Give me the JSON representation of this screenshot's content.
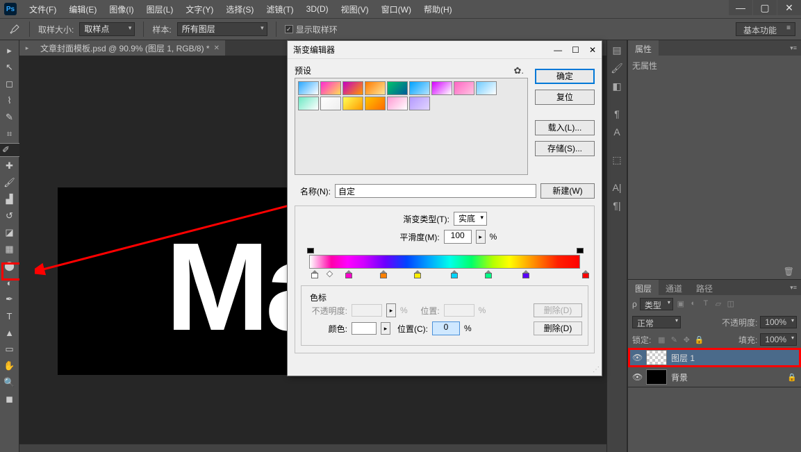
{
  "menu": [
    "文件(F)",
    "编辑(E)",
    "图像(I)",
    "图层(L)",
    "文字(Y)",
    "选择(S)",
    "滤镜(T)",
    "3D(D)",
    "视图(V)",
    "窗口(W)",
    "帮助(H)"
  ],
  "optbar": {
    "sample_size_label": "取样大小:",
    "sample_size_value": "取样点",
    "sample_label": "样本:",
    "sample_value": "所有图层",
    "show_ring": "显示取样环"
  },
  "workspace": "基本功能",
  "document_tab": "文章封面模板.psd @ 90.9% (图层 1, RGB/8) *",
  "canvas_text": "Ma",
  "properties": {
    "tab": "属性",
    "empty": "无属性"
  },
  "layers_panel": {
    "tabs": [
      "图层",
      "通道",
      "路径"
    ],
    "kind": "类型",
    "blend": "正常",
    "opacity_label": "不透明度:",
    "opacity_value": "100%",
    "lock_label": "锁定:",
    "fill_label": "填充:",
    "fill_value": "100%",
    "layers": [
      {
        "name": "图层 1"
      },
      {
        "name": "背景"
      }
    ]
  },
  "dialog": {
    "title": "渐变编辑器",
    "preset_label": "预设",
    "ok": "确定",
    "reset": "复位",
    "load": "载入(L)...",
    "save": "存储(S)...",
    "name_label": "名称(N):",
    "name_value": "自定",
    "new_btn": "新建(W)",
    "grad_type_label": "渐变类型(T):",
    "grad_type_value": "实底",
    "smooth_label": "平滑度(M):",
    "smooth_value": "100",
    "pct": "%",
    "stops_label": "色标",
    "opacity_label": "不透明度:",
    "location_label": "位置:",
    "location_label_c": "位置(C):",
    "location_value": "0",
    "color_label": "颜色:",
    "delete": "删除(D)"
  },
  "swatches": [
    "linear-gradient(135deg,#2aa8ff,#fff)",
    "linear-gradient(135deg,#ff2ad4,#ffdd55)",
    "linear-gradient(135deg,#c400c4,#ff9a00)",
    "linear-gradient(135deg,#ff7b00,#ffe69a)",
    "linear-gradient(135deg,#00c46a,#005a9a)",
    "linear-gradient(135deg,#00a2ff,#b4e3ff)",
    "linear-gradient(135deg,#d400ff,#fff)",
    "linear-gradient(135deg,#ff66c4,#ffc4e1)",
    "linear-gradient(135deg,#6ecbff,#fff)",
    "linear-gradient(135deg,#6ee8c4,#fff)",
    "linear-gradient(135deg,#fff,#eee)",
    "linear-gradient(135deg,#ffff55,#ff9a00)",
    "linear-gradient(135deg,#ffc400,#ff6a00)",
    "linear-gradient(135deg,#ff9ad4,#fff)",
    "linear-gradient(135deg,#b49aff,#e1d4ff)"
  ],
  "grad_stops": [
    {
      "pos": 2,
      "color": "#ffffff"
    },
    {
      "pos": 14,
      "color": "#ff00cc"
    },
    {
      "pos": 26,
      "color": "#ff8000"
    },
    {
      "pos": 38,
      "color": "#ffee00"
    },
    {
      "pos": 51,
      "color": "#00d4ff"
    },
    {
      "pos": 63,
      "color": "#00ff88"
    },
    {
      "pos": 76,
      "color": "#5a00ff"
    },
    {
      "pos": 97,
      "color": "#ff0000"
    }
  ]
}
